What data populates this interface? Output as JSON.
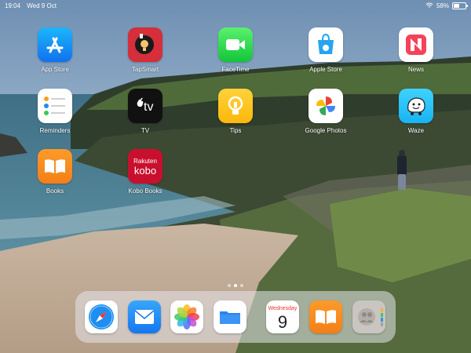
{
  "status": {
    "time": "19:04",
    "date": "Wed 9 Oct",
    "battery": "58%",
    "battery_level": 0.58
  },
  "apps": [
    {
      "label": "App Store"
    },
    {
      "label": "TapSmart"
    },
    {
      "label": "FaceTime"
    },
    {
      "label": "Apple Store"
    },
    {
      "label": "News"
    },
    {
      "label": "Reminders"
    },
    {
      "label": "TV"
    },
    {
      "label": "Tips"
    },
    {
      "label": "Google Photos"
    },
    {
      "label": "Waze"
    },
    {
      "label": "Books"
    },
    {
      "label": "Kobo Books"
    }
  ],
  "icon_text": {
    "tv": "tv",
    "rakuten": "Rakuten",
    "kobo": "kobo"
  },
  "dock": {
    "calendar_day": "Wednesday",
    "calendar_date": "9"
  },
  "page_dots": {
    "count": 3,
    "active": 1
  }
}
